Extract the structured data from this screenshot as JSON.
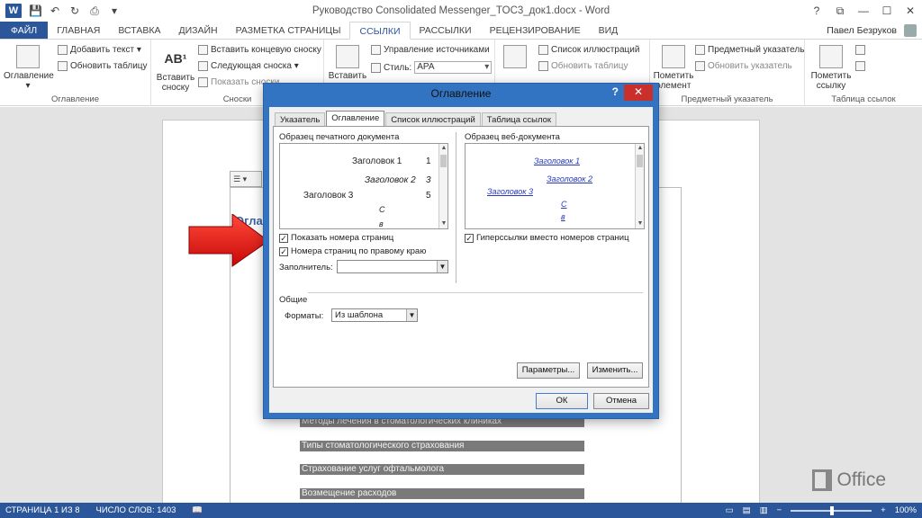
{
  "window": {
    "title": "Руководство Consolidated Messenger_TOC3_док1.docx - Word",
    "help": "?",
    "controls": [
      "⧉",
      "—",
      "☐",
      "✕"
    ]
  },
  "tabs": {
    "file": "ФАЙЛ",
    "items": [
      "ГЛАВНАЯ",
      "ВСТАВКА",
      "ДИЗАЙН",
      "РАЗМЕТКА СТРАНИЦЫ",
      "ССЫЛКИ",
      "РАССЫЛКИ",
      "РЕЦЕНЗИРОВАНИЕ",
      "ВИД"
    ],
    "active": "ССЫЛКИ",
    "user": "Павел Безруков"
  },
  "ribbon": {
    "toc_group": {
      "label": "Оглавление",
      "big": "Оглавление",
      "add_text": "Добавить текст ▾",
      "update": "Обновить таблицу"
    },
    "footnotes_group": {
      "label": "Сноски",
      "insert_footnote_l1": "Вставить",
      "insert_footnote_l2": "сноску",
      "insert_endnote": "Вставить концевую сноску",
      "next_footnote": "Следующая сноска ▾",
      "show_notes": "Показать сноски"
    },
    "citations_group": {
      "insert_l1": "Вставить",
      "manage_sources": "Управление источниками",
      "style_label": "Стиль:",
      "style_value": "APA"
    },
    "captions_group": {
      "figures_list": "Список иллюстраций",
      "update_table": "Обновить таблицу"
    },
    "index_group": {
      "label": "Предметный указатель",
      "mark_l1": "Пометить",
      "mark_l2": "элемент",
      "subject_index": "Предметный указатель",
      "update_index": "Обновить указатель"
    },
    "authorities_group": {
      "label": "Таблица ссылок",
      "mark_l1": "Пометить",
      "mark_l2": "ссылку"
    }
  },
  "document": {
    "heading": "Оглав",
    "toc_lines": [
      "Методы лечения в стоматологических клиниках",
      "Типы стоматологического страхования",
      "Страхование услуг офтальмолога",
      "Возмещение расходов"
    ]
  },
  "dialog": {
    "title": "Оглавление",
    "help": "?",
    "close": "✕",
    "tabs": [
      "Указатель",
      "Оглавление",
      "Список иллюстраций",
      "Таблица ссылок"
    ],
    "active_tab": "Оглавление",
    "print_preview_label": "Образец печатного документа",
    "web_preview_label": "Образец веб-документа",
    "print_preview": [
      {
        "text": "Заголовок 1",
        "num": "1"
      },
      {
        "text": "Заголовок 2",
        "num": "3"
      },
      {
        "text": "Заголовок 3",
        "num": "5"
      },
      {
        "text": "С",
        "num": ""
      },
      {
        "text": "в",
        "num": ""
      }
    ],
    "web_preview": [
      "Заголовок 1",
      "Заголовок 2",
      "Заголовок 3",
      "С",
      "в"
    ],
    "show_page_numbers": "Показать номера страниц",
    "right_align": "Номера страниц по правому краю",
    "hyperlinks": "Гиперссылки вместо номеров страниц",
    "leader_label": "Заполнитель:",
    "leader_value": "",
    "general_label": "Общие",
    "formats_label": "Форматы:",
    "formats_value": "Из шаблона",
    "options_btn": "Параметры...",
    "modify_btn": "Изменить...",
    "ok_btn": "ОК",
    "cancel_btn": "Отмена"
  },
  "status": {
    "page": "СТРАНИЦА 1 ИЗ 8",
    "words": "ЧИСЛО СЛОВ: 1403",
    "zoom": "100%",
    "zoom_minus": "−",
    "zoom_plus": "+"
  },
  "watermark": {
    "text": "Office"
  },
  "colors": {
    "accent": "#2b579a",
    "dialog_frame": "#3273c2",
    "close_red": "#c9302c",
    "arrow": "#e01010"
  }
}
